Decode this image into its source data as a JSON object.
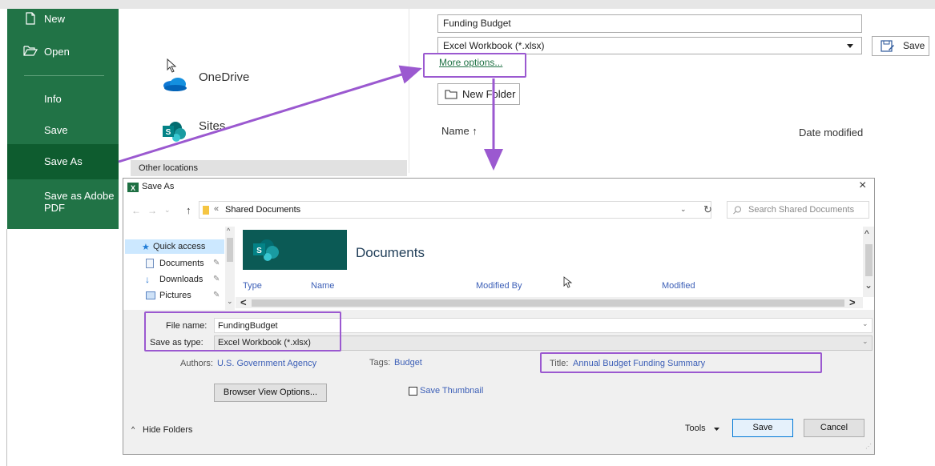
{
  "sidebar": {
    "items": [
      {
        "label": "New",
        "icon": "new-document-icon"
      },
      {
        "label": "Open",
        "icon": "folder-open-icon"
      },
      {
        "label": "Info"
      },
      {
        "label": "Save"
      },
      {
        "label": "Save As"
      },
      {
        "label": "Save as Adobe PDF"
      }
    ]
  },
  "places": {
    "onedrive": "OneDrive",
    "sites": "Sites",
    "other_locations": "Other locations"
  },
  "save_panel": {
    "filename": "Funding Budget",
    "filetype": "Excel Workbook (*.xlsx)",
    "save_label": "Save",
    "more_options": "More options...",
    "new_folder": "New Folder",
    "col_name": "Name ↑",
    "col_date": "Date modified"
  },
  "dialog": {
    "title": "Save As",
    "close": "×",
    "breadcrumb_prefix": "«",
    "path": "Shared Documents",
    "search_placeholder": "Search Shared Documents",
    "nav": {
      "quick_access": "Quick access",
      "items": [
        {
          "label": "Documents"
        },
        {
          "label": "Downloads"
        },
        {
          "label": "Pictures"
        }
      ]
    },
    "site_banner_letter": "S",
    "site_banner_title": "Documents",
    "columns": [
      "Type",
      "Name",
      "Modified By",
      "Modified"
    ],
    "file_name_label": "File name:",
    "file_name_value": "FundingBudget",
    "save_type_label": "Save as type:",
    "save_type_value": "Excel Workbook (*.xlsx)",
    "authors_label": "Authors:",
    "authors_value": "U.S. Government Agency",
    "tags_label": "Tags:",
    "tags_value": "Budget",
    "title_label": "Title:",
    "title_value": "Annual Budget Funding Summary",
    "browser_view": "Browser View Options...",
    "save_thumbnail": "Save Thumbnail",
    "hide_folders": "Hide Folders",
    "tools": "Tools",
    "save": "Save",
    "cancel": "Cancel"
  },
  "colors": {
    "excel_green": "#217346",
    "selected_green": "#0e5c2f",
    "annotation_purple": "#9b59d0",
    "link_blue": "#3c5fb7",
    "sharepoint_teal": "#0b5a55"
  }
}
